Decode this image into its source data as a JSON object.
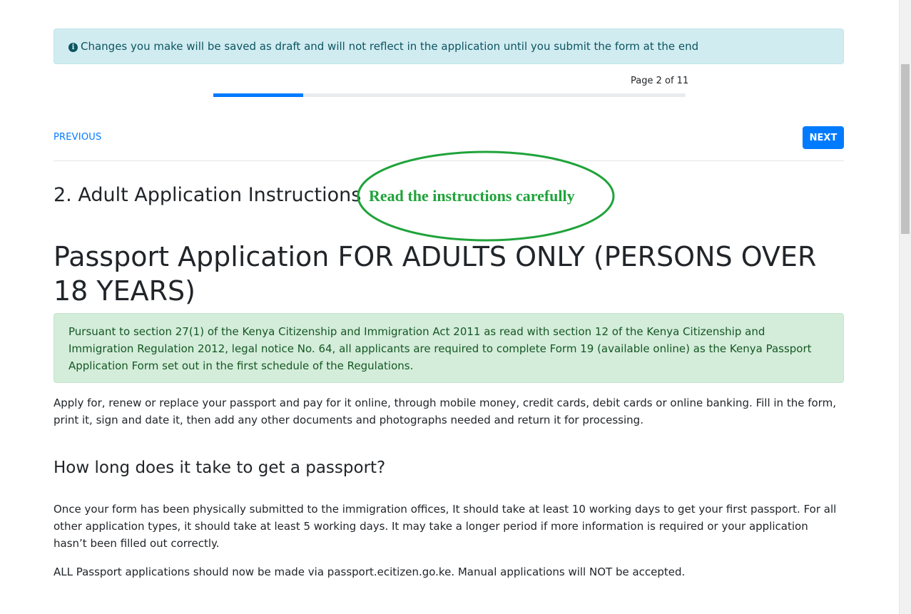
{
  "notice": {
    "icon": "info-circle-icon",
    "text": "Changes you make will be saved as draft and will not reflect in the application until you submit the form at the end"
  },
  "pagination": {
    "page_text": "Page 2 of 11",
    "progress_fraction": 0.19
  },
  "nav": {
    "previous_label": "PREVIOUS",
    "next_label": "NEXT"
  },
  "section": {
    "title": "2. Adult Application Instructions"
  },
  "annotation": {
    "text": "Read the instructions carefully",
    "color": "#1fa33a"
  },
  "content": {
    "heading": "Passport Application FOR ADULTS ONLY (PERSONS OVER 18 YEARS)",
    "legal_notice": "Pursuant to section 27(1) of the Kenya Citizenship and Immigration Act 2011 as read with section 12 of the Kenya Citizenship and Immigration Regulation 2012, legal notice No. 64, all applicants are required to complete Form 19 (available online) as the Kenya Passport Application Form set out in the first schedule of the Regulations.",
    "intro": "Apply for, renew or replace your passport and pay for it online, through mobile money, credit cards, debit cards or online banking. Fill in the form, print it, sign and date it, then add any other documents and photographs needed and return it for processing.",
    "faq_heading": "How long does it take to get a passport?",
    "faq_answer": "Once your form has been physically submitted to the immigration offices, It should take at least 10 working days to get your first passport. For all other application types, it should take at least 5 working days. It may take a longer period if more information is required or your application hasn’t been filled out correctly.",
    "online_notice": "ALL Passport applications should now be made via passport.ecitizen.go.ke. Manual applications will NOT be accepted."
  },
  "colors": {
    "primary": "#007bff",
    "info_bg": "#d1ecf1",
    "success_bg": "#d4edda",
    "success_text": "#155724"
  }
}
